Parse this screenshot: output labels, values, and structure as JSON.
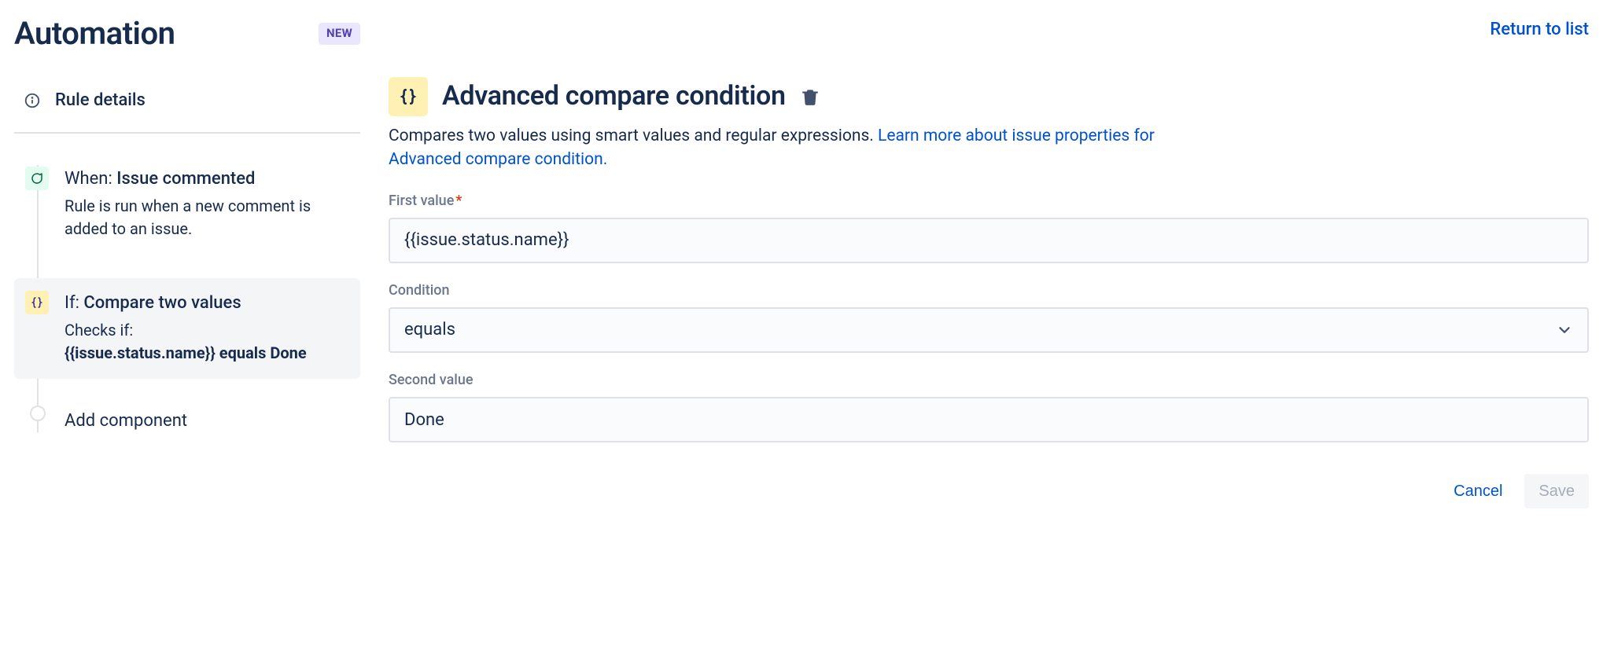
{
  "header": {
    "title": "Automation",
    "new_badge": "NEW",
    "return_link": "Return to list"
  },
  "sidebar": {
    "rule_details_label": "Rule details",
    "steps": [
      {
        "icon": "comment-icon",
        "title_prefix": "When: ",
        "title": "Issue commented",
        "desc": "Rule is run when a new comment is added to an issue."
      },
      {
        "icon": "braces-icon",
        "title_prefix": "If: ",
        "title": "Compare two values",
        "desc_prefix": "Checks if:",
        "desc_bold": "{{issue.status.name}} equals Done"
      }
    ],
    "add_component": "Add component"
  },
  "main": {
    "heading": "Advanced compare condition",
    "description_text": "Compares two values using smart values and regular expressions. ",
    "description_link": "Learn more about issue properties for Advanced compare condition.",
    "fields": {
      "first_value": {
        "label": "First value",
        "required": true,
        "value": "{{issue.status.name}}"
      },
      "condition": {
        "label": "Condition",
        "value": "equals"
      },
      "second_value": {
        "label": "Second value",
        "value": "Done"
      }
    },
    "actions": {
      "cancel": "Cancel",
      "save": "Save"
    }
  }
}
